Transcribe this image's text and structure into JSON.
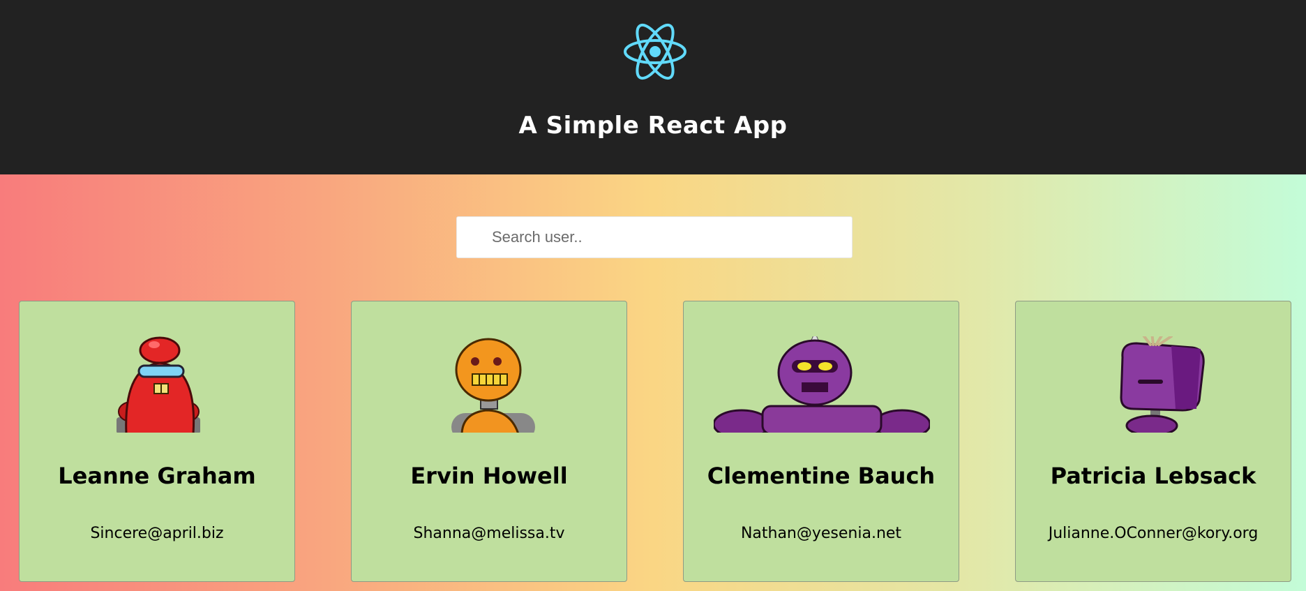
{
  "header": {
    "logo_icon": "react-atom-icon",
    "title": "A Simple React App",
    "logo_color": "#61dafb",
    "background": "#222222"
  },
  "search": {
    "placeholder": "Search user..",
    "value": ""
  },
  "cards": [
    {
      "name": "Leanne Graham",
      "email": "Sincere@april.biz",
      "avatar": "red-robot-avatar"
    },
    {
      "name": "Ervin Howell",
      "email": "Shanna@melissa.tv",
      "avatar": "orange-robot-avatar"
    },
    {
      "name": "Clementine Bauch",
      "email": "Nathan@yesenia.net",
      "avatar": "purple-robot-avatar"
    },
    {
      "name": "Patricia Lebsack",
      "email": "Julianne.OConner@kory.org",
      "avatar": "purple-robot-avatar"
    }
  ],
  "colors": {
    "card_background": "#bfdf9e",
    "gradient_start": "#f87c7c",
    "gradient_mid": "#fad684",
    "gradient_end": "#c3fcd8"
  }
}
